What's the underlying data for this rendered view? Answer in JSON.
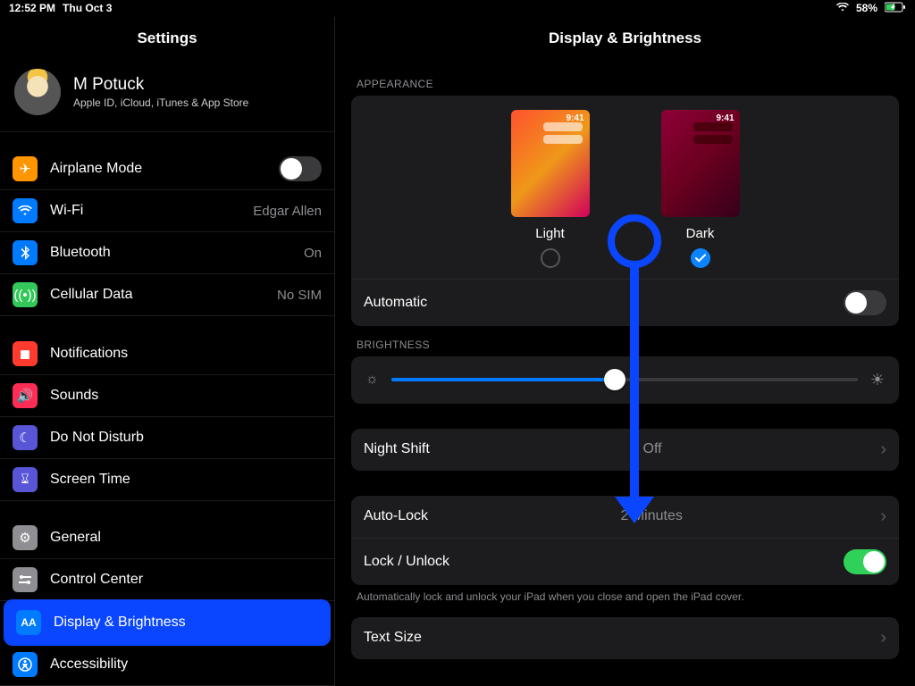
{
  "statusbar": {
    "time": "12:52 PM",
    "date": "Thu Oct 3",
    "battery_pct": "58%"
  },
  "sidebar": {
    "title": "Settings",
    "profile": {
      "name": "M Potuck",
      "sub": "Apple ID, iCloud, iTunes & App Store"
    },
    "group1": [
      {
        "icon": "airplane",
        "color": "orange",
        "label": "Airplane Mode",
        "toggle_off": true
      },
      {
        "icon": "wifi",
        "color": "blue",
        "label": "Wi-Fi",
        "detail": "Edgar Allen"
      },
      {
        "icon": "bluetooth",
        "color": "blue",
        "label": "Bluetooth",
        "detail": "On"
      },
      {
        "icon": "antenna",
        "color": "green",
        "label": "Cellular Data",
        "detail": "No SIM"
      }
    ],
    "group2": [
      {
        "icon": "bell",
        "color": "red",
        "label": "Notifications"
      },
      {
        "icon": "speaker",
        "color": "pink",
        "label": "Sounds"
      },
      {
        "icon": "moon",
        "color": "purple",
        "label": "Do Not Disturb"
      },
      {
        "icon": "hourglass",
        "color": "indigo",
        "label": "Screen Time"
      }
    ],
    "group3": [
      {
        "icon": "gear",
        "color": "gray",
        "label": "General"
      },
      {
        "icon": "switches",
        "color": "gray",
        "label": "Control Center"
      },
      {
        "icon": "aa",
        "color": "blue",
        "label": "Display & Brightness",
        "selected": true
      },
      {
        "icon": "figure",
        "color": "blue",
        "label": "Accessibility"
      }
    ]
  },
  "detail": {
    "title": "Display & Brightness",
    "appearance_hdr": "APPEARANCE",
    "light_label": "Light",
    "dark_label": "Dark",
    "preview_clock": "9:41",
    "automatic_label": "Automatic",
    "brightness_hdr": "BRIGHTNESS",
    "night_shift_label": "Night Shift",
    "night_shift_val": "Off",
    "autolock_label": "Auto-Lock",
    "autolock_val": "2 Minutes",
    "lock_unlock_label": "Lock / Unlock",
    "lock_unlock_note": "Automatically lock and unlock your iPad when you close and open the iPad cover.",
    "text_size_label": "Text Size"
  }
}
